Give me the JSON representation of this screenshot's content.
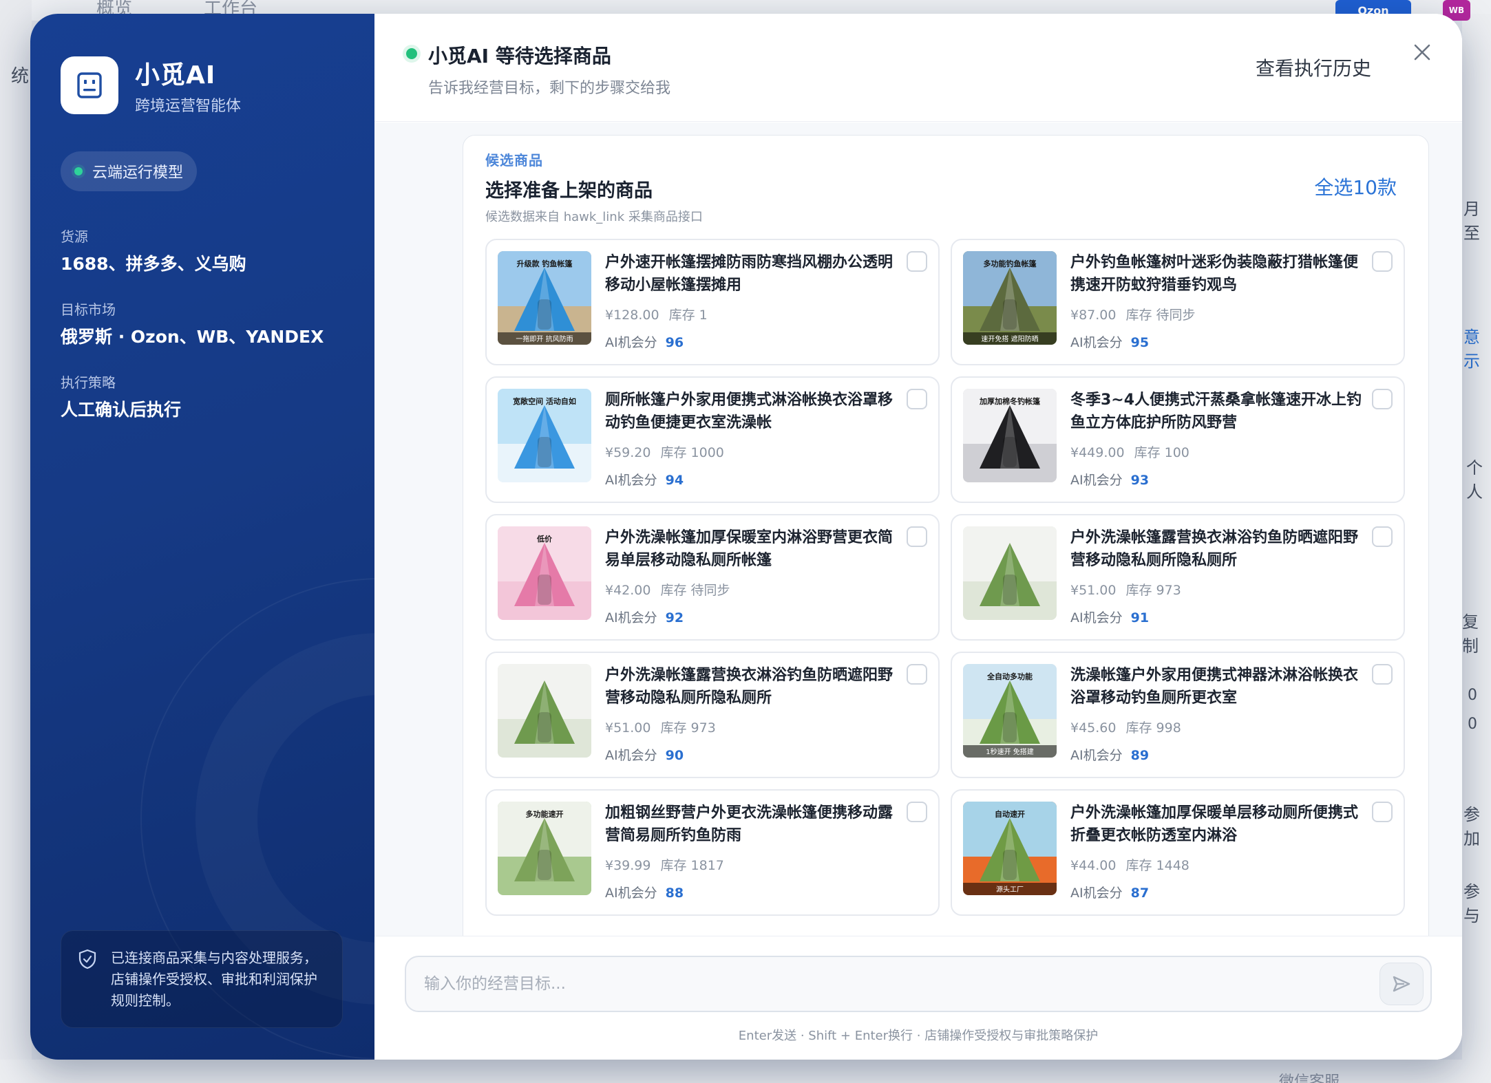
{
  "background": {
    "nav_overview": "概览",
    "nav_workbench": "工作台",
    "left_char": "统",
    "ozon_badge": "Ozon",
    "wb_badge": "WB",
    "right_frags": [
      "月至",
      "意示",
      "个人",
      "复制",
      "0",
      "0",
      "参加",
      "参与"
    ],
    "bottom_text": "微信客服"
  },
  "sidebar": {
    "brand_name": "小觅AI",
    "brand_subtitle": "跨境运营智能体",
    "cloud_label": "云端运行模型",
    "fields": [
      {
        "label": "货源",
        "value": "1688、拼多多、义乌购"
      },
      {
        "label": "目标市场",
        "value": "俄罗斯 · Ozon、WB、YANDEX"
      },
      {
        "label": "执行策略",
        "value": "人工确认后执行"
      }
    ],
    "notice": "已连接商品采集与内容处理服务，店铺操作受授权、审批和利润保护规则控制。"
  },
  "header": {
    "title": "小觅AI 等待选择商品",
    "subtitle": "告诉我经营目标，剩下的步骤交给我",
    "history_label": "查看执行历史"
  },
  "candidates": {
    "eyebrow": "候选商品",
    "title": "选择准备上架的商品",
    "note": "候选数据来自 hawk_link 采集商品接口",
    "select_all_label": "全选10款",
    "score_label": "AI机会分",
    "items": [
      {
        "title": "户外速开帐篷摆摊防雨防寒挡风棚办公透明移动小屋帐篷摆摊用",
        "price": "¥128.00",
        "stock": "库存 1",
        "score": "96",
        "thumb_tag": "升级款 钓鱼帐篷",
        "thumb_caption": "一拖即开 抗风防雨",
        "colors": [
          "#2f8fd6",
          "#9cc9ec",
          "#c9b48f"
        ]
      },
      {
        "title": "户外钓鱼帐篷树叶迷彩伪装隐蔽打猎帐篷便携速开防蚊狩猎垂钓观鸟",
        "price": "¥87.00",
        "stock": "库存 待同步",
        "score": "95",
        "thumb_tag": "多功能钓鱼帐篷",
        "thumb_caption": "速开免搭 遮阳防晒",
        "colors": [
          "#5c6a3e",
          "#8fb6d8",
          "#7a8b4b"
        ]
      },
      {
        "title": "厕所帐篷户外家用便携式淋浴帐换衣浴罩移动钓鱼便捷更衣室洗澡帐",
        "price": "¥59.20",
        "stock": "库存 1000",
        "score": "94",
        "thumb_tag": "宽敞空间 活动自如",
        "thumb_caption": "",
        "colors": [
          "#3a97e0",
          "#bfe3f7",
          "#e9f4fb"
        ]
      },
      {
        "title": "冬季3~4人便携式汗蒸桑拿帐篷速开冰上钓鱼立方体庇护所防风野营",
        "price": "¥449.00",
        "stock": "库存 100",
        "score": "93",
        "thumb_tag": "加厚加棉冬钓帐篷",
        "thumb_caption": "",
        "colors": [
          "#1f1f22",
          "#f1f1f3",
          "#cfcfd4"
        ]
      },
      {
        "title": "户外洗澡帐篷加厚保暖室内淋浴野营更衣简易单层移动隐私厕所帐篷",
        "price": "¥42.00",
        "stock": "库存 待同步",
        "score": "92",
        "thumb_tag": "低价",
        "thumb_caption": "",
        "colors": [
          "#e57aa8",
          "#f7dbe7",
          "#f3c6d9"
        ]
      },
      {
        "title": "户外洗澡帐篷露营换衣淋浴钓鱼防晒遮阳野营移动隐私厕所隐私厕所",
        "price": "¥51.00",
        "stock": "库存 973",
        "score": "91",
        "thumb_tag": "",
        "thumb_caption": "",
        "colors": [
          "#6f9a4e",
          "#f2f3f0",
          "#dfe6d8"
        ]
      },
      {
        "title": "户外洗澡帐篷露营换衣淋浴钓鱼防晒遮阳野营移动隐私厕所隐私厕所",
        "price": "¥51.00",
        "stock": "库存 973",
        "score": "90",
        "thumb_tag": "",
        "thumb_caption": "",
        "colors": [
          "#6f9a4e",
          "#f2f3f0",
          "#dfe6d8"
        ]
      },
      {
        "title": "洗澡帐篷户外家用便携式神器沐淋浴帐换衣浴罩移动钓鱼厕所更衣室",
        "price": "¥45.60",
        "stock": "库存 998",
        "score": "89",
        "thumb_tag": "全自动多功能",
        "thumb_caption": "1秒速开 免搭建",
        "colors": [
          "#6a9a46",
          "#cfe5f2",
          "#e8efe2"
        ]
      },
      {
        "title": "加粗钢丝野营户外更衣洗澡帐篷便携移动露营简易厕所钓鱼防雨",
        "price": "¥39.99",
        "stock": "库存 1817",
        "score": "88",
        "thumb_tag": "多功能速开",
        "thumb_caption": "",
        "colors": [
          "#7da35a",
          "#eef2ea",
          "#a9c98f"
        ]
      },
      {
        "title": "户外洗澡帐篷加厚保暖单层移动厕所便携式折叠更衣帐防透室内淋浴",
        "price": "¥44.00",
        "stock": "库存 1448",
        "score": "87",
        "thumb_tag": "自动速开",
        "thumb_caption": "源头工厂",
        "colors": [
          "#6f9b45",
          "#a7d3e8",
          "#e86b2a"
        ]
      }
    ]
  },
  "composer": {
    "placeholder": "输入你的经营目标...",
    "hint": "Enter发送 · Shift + Enter换行 · 店铺操作受授权与审批策略保护"
  }
}
